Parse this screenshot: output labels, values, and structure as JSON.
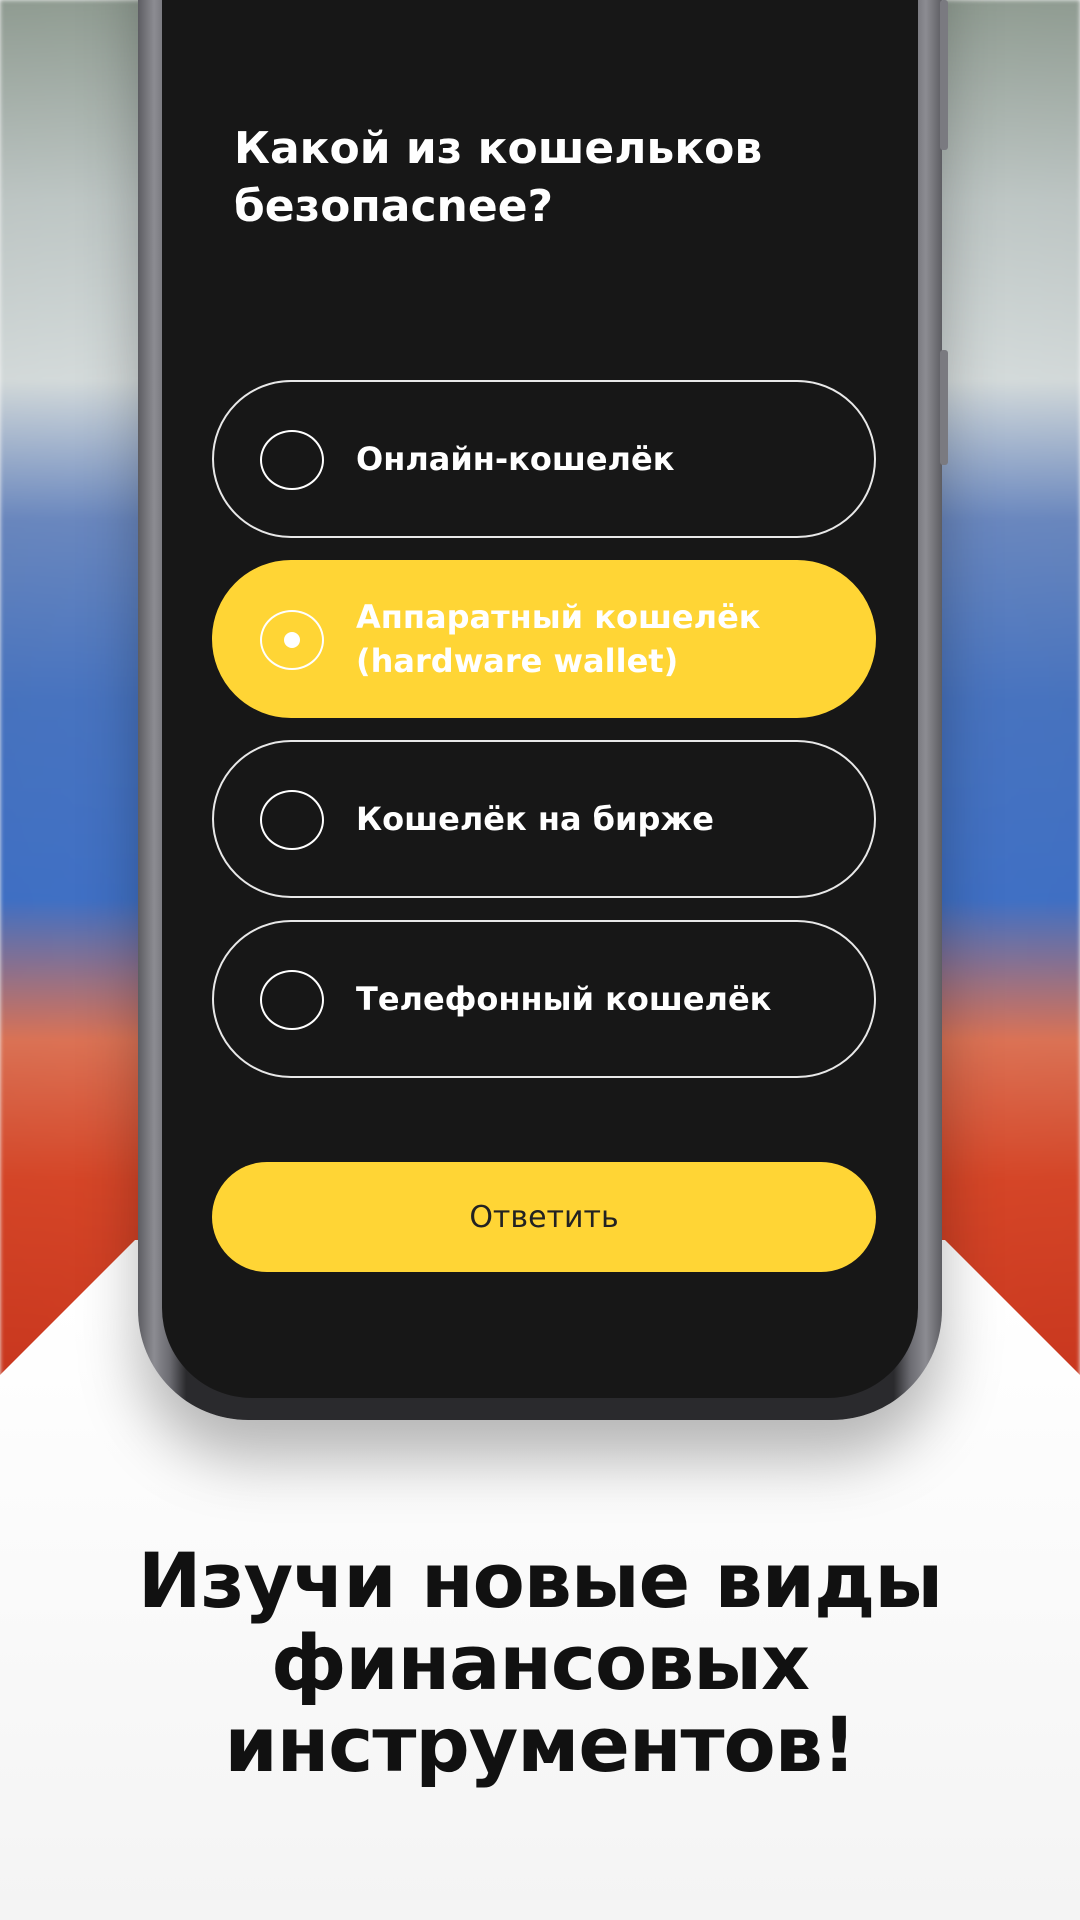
{
  "quiz": {
    "question": "Какой из кошельков безопасnee?",
    "options": [
      {
        "label": "Онлайн-кошелёк",
        "selected": false
      },
      {
        "label": "Аппаратный кошелёк (hardware wallet)",
        "selected": true
      },
      {
        "label": "Кошелёк на бирже",
        "selected": false
      },
      {
        "label": "Телефонный кошелёк",
        "selected": false
      }
    ],
    "submit_label": "Ответить"
  },
  "promo": {
    "headline": "Изучи новые виды финансовых инструментов!"
  },
  "colors": {
    "accent": "#ffd535",
    "screen_bg": "#171717"
  },
  "icons": {
    "logo": "yellow-rings-logo-icon",
    "radio_empty": "radio-unchecked-icon",
    "radio_checked": "radio-checked-icon"
  }
}
